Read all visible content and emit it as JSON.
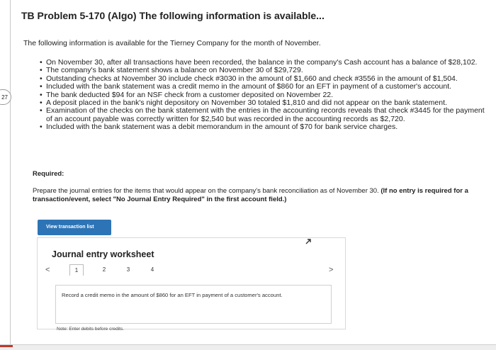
{
  "side_tab_label": "27",
  "problem": {
    "title": "TB Problem 5-170 (Algo) The following information is available...",
    "intro": "The following information is available for the Tierney Company for the month of November.",
    "facts": [
      "On November 30, after all transactions have been recorded, the balance in the company's Cash account has a balance of $28,102.",
      "The company's bank statement shows a balance on November 30 of $29,729.",
      "Outstanding checks at November 30 include check #3030 in the amount of $1,660 and check #3556 in the amount of $1,504.",
      "Included with the bank statement was a credit memo in the amount of $860 for an EFT in payment of a customer's account.",
      "The bank deducted $94 for an NSF check from a customer deposited on November 22.",
      "A deposit placed in the bank's night depository on November 30 totaled $1,810 and did not appear on the bank statement.",
      "Examination of the checks on the bank statement with the entries in the accounting records reveals that check #3445 for the payment of an account payable was correctly written for $2,540 but was recorded in the accounting records as $2,720.",
      "Included with the bank statement was a debit memorandum in the amount of $70 for bank service charges."
    ]
  },
  "required": {
    "heading": "Required:",
    "text": "Prepare the journal entries for the items that would appear on the company's bank reconciliation as of November 30.",
    "bold_note": "(If no entry is required for a transaction/event, select \"No Journal Entry Required\" in the first account field.)"
  },
  "view_transaction_button": "View transaction list",
  "worksheet": {
    "title": "Journal entry worksheet",
    "prev_symbol": "<",
    "next_symbol": ">",
    "pages": [
      "1",
      "2",
      "3",
      "4"
    ],
    "active_page": 1,
    "entry_description": "Record a credit memo in the amount of $860 for an EFT in payment of a customer's account.",
    "note": "Note: Enter debits before credits."
  },
  "colors": {
    "button_blue": "#2d74b6",
    "bottom_accent": "#c0392b"
  }
}
